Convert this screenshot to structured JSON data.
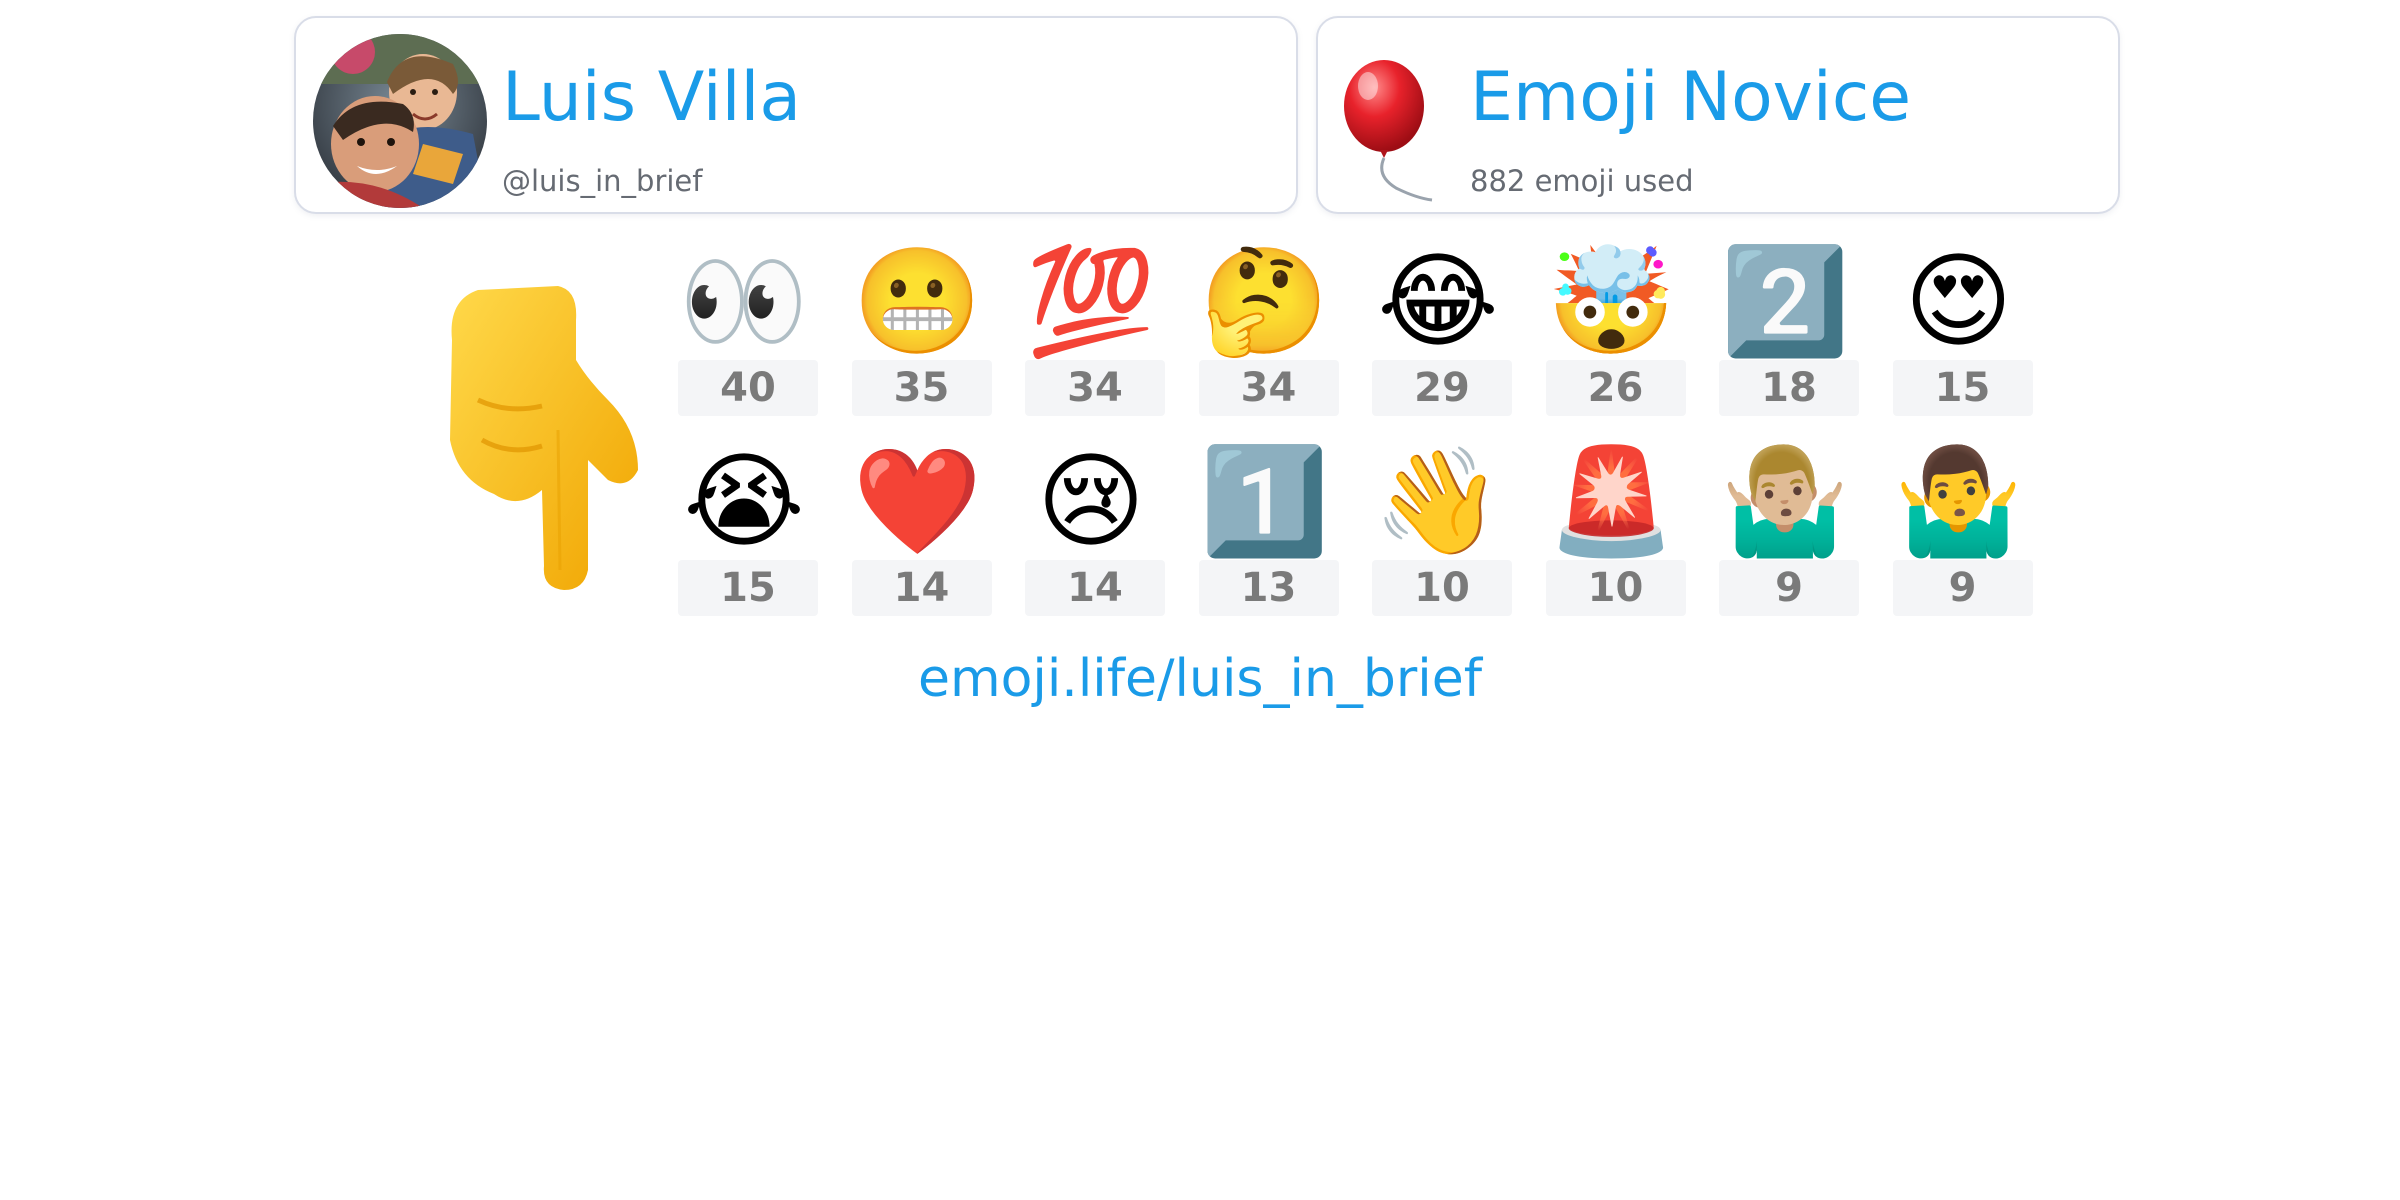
{
  "profile": {
    "name": "Luis Villa",
    "handle": "@luis_in_brief"
  },
  "rank": {
    "title": "Emoji Novice",
    "subtitle": "882 emoji used",
    "icon": "balloon-icon"
  },
  "grid": {
    "pointer_icon": "backhand-index-pointing-down-icon",
    "rows": [
      [
        {
          "emoji": "👀",
          "name": "eyes-icon",
          "count": "40"
        },
        {
          "emoji": "😬",
          "name": "grimacing-face-icon",
          "count": "35"
        },
        {
          "emoji": "💯",
          "name": "hundred-points-icon",
          "count": "34"
        },
        {
          "emoji": "🤔",
          "name": "thinking-face-icon",
          "count": "34"
        },
        {
          "emoji": "😂",
          "name": "tears-of-joy-icon",
          "count": "29"
        },
        {
          "emoji": "🤯",
          "name": "exploding-head-icon",
          "count": "26"
        },
        {
          "emoji": "2️⃣",
          "name": "keycap-two-icon",
          "count": "18"
        },
        {
          "emoji": "😍",
          "name": "heart-eyes-icon",
          "count": "15"
        }
      ],
      [
        {
          "emoji": "😭",
          "name": "loudly-crying-face-icon",
          "count": "15"
        },
        {
          "emoji": "❤️",
          "name": "red-heart-icon",
          "count": "14"
        },
        {
          "emoji": "😢",
          "name": "crying-face-icon",
          "count": "14"
        },
        {
          "emoji": "1️⃣",
          "name": "keycap-one-icon",
          "count": "13"
        },
        {
          "emoji": "👋",
          "name": "waving-hand-icon",
          "count": "10"
        },
        {
          "emoji": "🚨",
          "name": "police-light-icon",
          "count": "10"
        },
        {
          "emoji": "🤷🏼‍♂️",
          "name": "man-shrugging-light-icon",
          "count": "9"
        },
        {
          "emoji": "🤷‍♂️",
          "name": "man-shrugging-icon",
          "count": "9"
        }
      ]
    ]
  },
  "footer": {
    "link": "emoji.life/luis_in_brief"
  },
  "colors": {
    "accent": "#1a9be8",
    "subtle_text": "#666b73",
    "count_text": "#7a7a7a",
    "count_bg": "#f4f5f7",
    "card_border": "#d9dde8"
  }
}
